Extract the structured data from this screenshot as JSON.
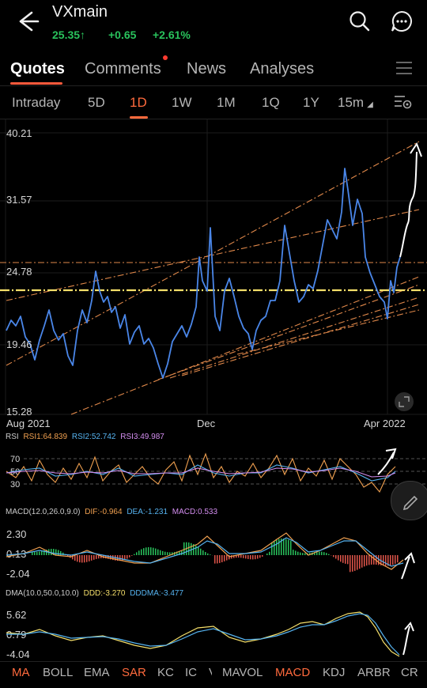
{
  "header": {
    "title": "VXmain",
    "price": "25.35",
    "change": "+0.65",
    "change_pct": "+2.61%",
    "accent_up": "#29c25c"
  },
  "tabs": [
    {
      "label": "Quotes",
      "active": true
    },
    {
      "label": "Comments",
      "active": false,
      "badge": true
    },
    {
      "label": "News",
      "active": false
    },
    {
      "label": "Analyses",
      "active": false
    }
  ],
  "periods": [
    {
      "label": "Intraday"
    },
    {
      "label": "5D"
    },
    {
      "label": "1D",
      "active": true
    },
    {
      "label": "1W"
    },
    {
      "label": "1M"
    },
    {
      "label": "1Q"
    },
    {
      "label": "1Y"
    },
    {
      "label": "15m"
    }
  ],
  "main_chart": {
    "y_ticks": [
      "40.21",
      "31.57",
      "24.78",
      "19.46",
      "15.28"
    ],
    "x_ticks": [
      "Aug 2021",
      "Dec",
      "Apr 2022"
    ],
    "series_color": "#4a86e8"
  },
  "rsi": {
    "label": "RSI",
    "rsi1": "RSI1:64.839",
    "rsi2": "RSI2:52.742",
    "rsi3": "RSI3:49.987",
    "ticks": [
      "70",
      "50",
      "30"
    ]
  },
  "macd": {
    "label": "MACD(12.0,26.0,9.0)",
    "dif": "DIF:-0.964",
    "dea": "DEA:-1.231",
    "macd": "MACD:0.533",
    "ticks": [
      "2.30",
      "0.13",
      "-2.04"
    ]
  },
  "dma": {
    "label": "DMA(10.0,50.0,10.0)",
    "ddd": "DDD:-3.270",
    "dddma": "DDDMA:-3.477",
    "ticks": [
      "5.62",
      "0.79",
      "-4.04"
    ]
  },
  "bottom_tabs": [
    {
      "label": "MA",
      "hl": true
    },
    {
      "label": "BOLL"
    },
    {
      "label": "EMA"
    },
    {
      "label": "SAR",
      "hl": true
    },
    {
      "label": "KC"
    },
    {
      "label": "IC"
    },
    {
      "label": "V"
    },
    {
      "label": "MAVOL"
    },
    {
      "label": "MACD",
      "hl": true
    },
    {
      "label": "KDJ"
    },
    {
      "label": "ARBR"
    },
    {
      "label": "CR"
    }
  ]
}
